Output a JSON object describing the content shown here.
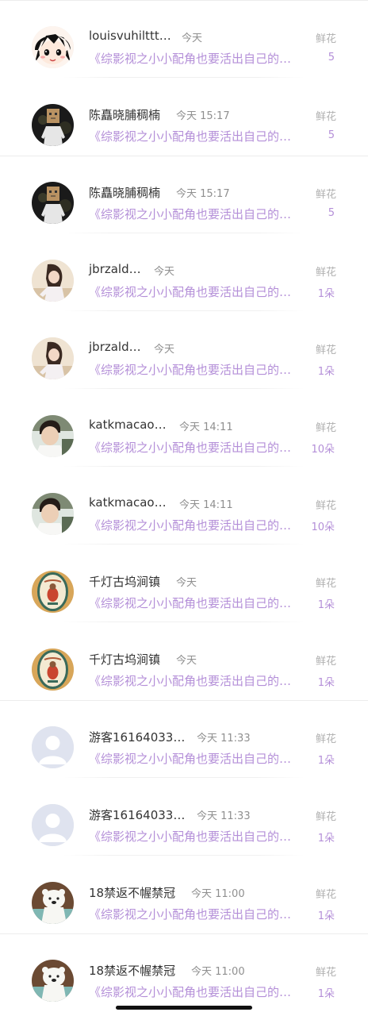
{
  "rows": [
    {
      "avatar": "anime-girl",
      "name": "louisvuhilttt…",
      "time": "今天",
      "desc": "《综影视之小小配角也要活出自己的…",
      "gift_type": "鲜花",
      "gift_count": "5"
    },
    {
      "avatar": "paper-bag-man",
      "name": "陈矗晓脯稠楠",
      "time": "今天 15:17",
      "desc": "《综影视之小小配角也要活出自己的…",
      "gift_type": "鲜花",
      "gift_count": "5"
    },
    {
      "avatar": "paper-bag-man",
      "name": "陈矗晓脯稠楠",
      "time": "今天 15:17",
      "desc": "《综影视之小小配角也要活出自己的…",
      "gift_type": "鲜花",
      "gift_count": "5"
    },
    {
      "avatar": "girl-photo",
      "name": "jbrzald…",
      "time": "今天",
      "desc": "《综影视之小小配角也要活出自己的…",
      "gift_type": "鲜花",
      "gift_count": "1朵"
    },
    {
      "avatar": "girl-photo",
      "name": "jbrzald…",
      "time": "今天",
      "desc": "《综影视之小小配角也要活出自己的…",
      "gift_type": "鲜花",
      "gift_count": "1朵"
    },
    {
      "avatar": "boy-photo",
      "name": "katkmacao…",
      "time": "今天 14:11",
      "desc": "《综影视之小小配角也要活出自己的…",
      "gift_type": "鲜花",
      "gift_count": "10朵"
    },
    {
      "avatar": "boy-photo",
      "name": "katkmacao…",
      "time": "今天 14:11",
      "desc": "《综影视之小小配角也要活出自己的…",
      "gift_type": "鲜花",
      "gift_count": "10朵"
    },
    {
      "avatar": "badge-emblem",
      "name": "千灯古坞涧镇",
      "time": "今天",
      "desc": "《综影视之小小配角也要活出自己的…",
      "gift_type": "鲜花",
      "gift_count": "1朵"
    },
    {
      "avatar": "badge-emblem",
      "name": "千灯古坞涧镇",
      "time": "今天",
      "desc": "《综影视之小小配角也要活出自己的…",
      "gift_type": "鲜花",
      "gift_count": "1朵"
    },
    {
      "avatar": "default-user",
      "name": "游客16164033…",
      "time": "今天 11:33",
      "desc": "《综影视之小小配角也要活出自己的…",
      "gift_type": "鲜花",
      "gift_count": "1朵"
    },
    {
      "avatar": "default-user",
      "name": "游客16164033…",
      "time": "今天 11:33",
      "desc": "《综影视之小小配角也要活出自己的…",
      "gift_type": "鲜花",
      "gift_count": "1朵"
    },
    {
      "avatar": "polar-bear",
      "name": "18禁返不幄禁冠",
      "time": "今天 11:00",
      "desc": "《综影视之小小配角也要活出自己的…",
      "gift_type": "鲜花",
      "gift_count": "1朵"
    },
    {
      "avatar": "polar-bear",
      "name": "18禁返不幄禁冠",
      "time": "今天 11:00",
      "desc": "《综影视之小小配角也要活出自己的…",
      "gift_type": "鲜花",
      "gift_count": "1朵"
    }
  ]
}
